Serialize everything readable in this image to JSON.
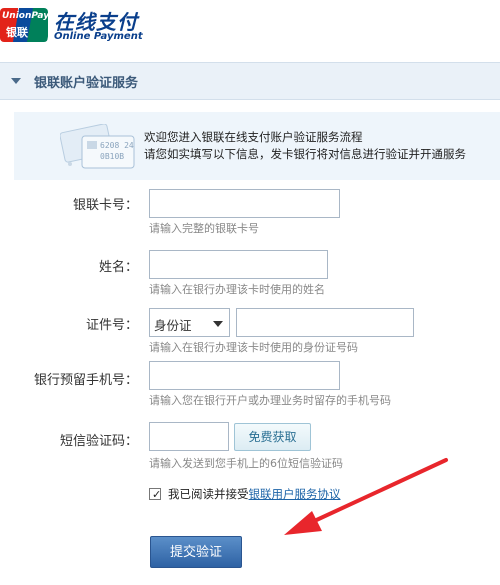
{
  "header": {
    "logo_text_en": "UnionPay",
    "logo_text_cn": "银联",
    "brand_cn": "在线支付",
    "brand_en": "Online Payment"
  },
  "section": {
    "title": "银联账户验证服务"
  },
  "intro": {
    "line1": "欢迎您进入银联在线支付账户验证服务流程",
    "line2": "请您如实填写以下信息，发卡银行将对信息进行验证并开通服务"
  },
  "form": {
    "card": {
      "label": "银联卡号：",
      "hint": "请输入完整的银联卡号",
      "value": ""
    },
    "name": {
      "label": "姓名：",
      "hint": "请输入在银行办理该卡时使用的姓名",
      "value": ""
    },
    "id": {
      "label": "证件号：",
      "type_selected": "身份证",
      "hint": "请输入在银行办理该卡时使用的身份证号码",
      "value": ""
    },
    "phone": {
      "label": "银行预留手机号：",
      "hint": "请输入您在银行开户或办理业务时留存的手机号码",
      "value": ""
    },
    "sms": {
      "label": "短信验证码：",
      "button": "免费获取",
      "hint": "请输入发送到您手机上的6位短信验证码",
      "value": ""
    },
    "agree": {
      "checked": true,
      "text": "我已阅读并接受",
      "link": "银联用户服务协议"
    },
    "submit": "提交验证"
  },
  "colors": {
    "accent": "#2e62a4",
    "arrow": "#e8262c"
  }
}
